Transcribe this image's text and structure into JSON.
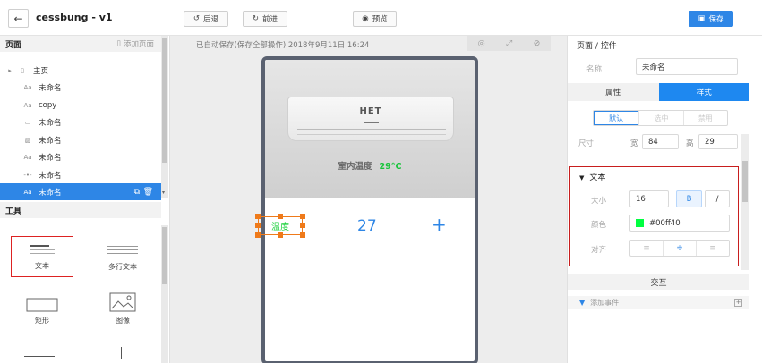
{
  "header": {
    "title": "cessbung - v1",
    "undo_label": "后退",
    "redo_label": "前进",
    "preview_label": "预览",
    "save_label": "保存"
  },
  "pages_panel": {
    "title": "页面",
    "add_label": "添加页面",
    "items": [
      {
        "label": "主页",
        "icon": "page-icon"
      },
      {
        "label": "未命名",
        "icon": "text-icon"
      },
      {
        "label": "copy",
        "icon": "text-icon"
      },
      {
        "label": "未命名",
        "icon": "rect-icon"
      },
      {
        "label": "未命名",
        "icon": "image-icon"
      },
      {
        "label": "未命名",
        "icon": "text-icon"
      },
      {
        "label": "未命名",
        "icon": "line-icon"
      },
      {
        "label": "未命名",
        "icon": "text-icon"
      }
    ]
  },
  "tools_panel": {
    "title": "工具",
    "items": [
      {
        "label": "文本"
      },
      {
        "label": "多行文本"
      },
      {
        "label": "矩形"
      },
      {
        "label": "图像"
      }
    ]
  },
  "canvas": {
    "autosave": "已自动保存(保存全部操作) 2018年9月11日 16:24",
    "ac_brand": "HET",
    "room_label": "室内温度",
    "room_temp": "29°C",
    "selected_text": "温度",
    "temp_value": "27",
    "plus": "+"
  },
  "props": {
    "title": "页面 / 控件",
    "name_label": "名称",
    "name_value": "未命名",
    "tab_attr": "属性",
    "tab_style": "样式",
    "state_default": "默认",
    "state_selected": "选中",
    "state_disabled": "禁用",
    "size_label": "尺寸",
    "width_label": "宽",
    "width_value": "84",
    "height_label": "高",
    "height_value": "29",
    "text_section": "文本",
    "font_size_label": "大小",
    "font_size_value": "16",
    "bold_label": "B",
    "italic_label": "/",
    "color_label": "颜色",
    "color_value": "#00ff40",
    "align_label": "对齐",
    "interaction_title": "交互",
    "add_event_label": "添加事件"
  },
  "colors": {
    "accent": "#2e86e6",
    "temperature_green": "#17c43a",
    "selection_orange": "#ef7a1a",
    "text_color": "#00ff40"
  }
}
